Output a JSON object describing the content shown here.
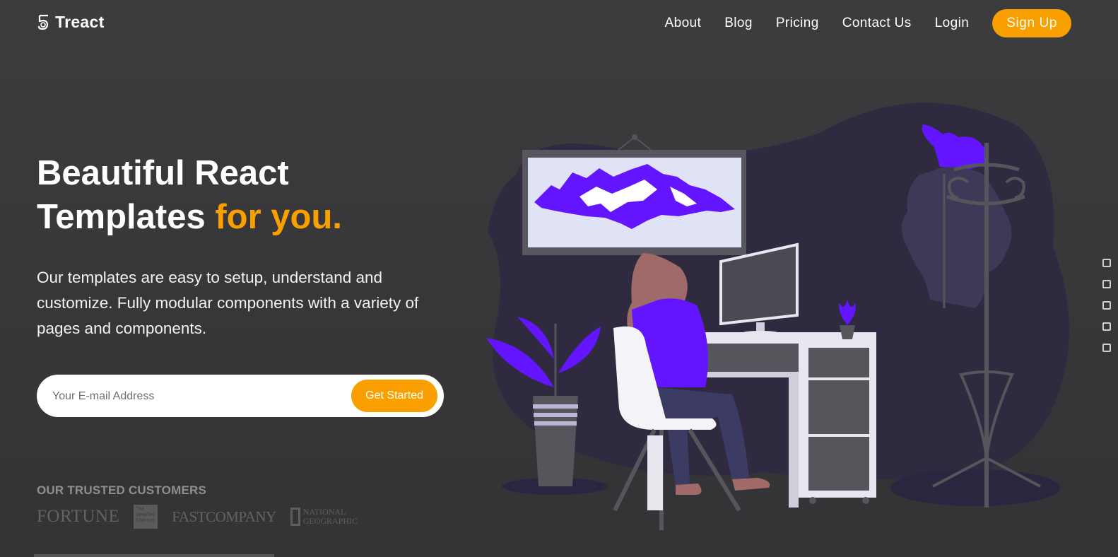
{
  "header": {
    "brand": "Treact",
    "nav_links": [
      "About",
      "Blog",
      "Pricing",
      "Contact Us",
      "Login"
    ],
    "signup_label": "Sign Up"
  },
  "hero": {
    "title_line1": "Beautiful React",
    "title_line2": "Templates",
    "title_accent": "for you.",
    "description": "Our templates are easy to setup, understand and customize. Fully modular components with a variety of pages and components.",
    "email_placeholder": "Your E-mail Address",
    "cta_label": "Get Started"
  },
  "customers": {
    "title": "OUR TRUSTED CUSTOMERS",
    "logos": {
      "fortune": "FORTUNE",
      "weather": "The Weather Channel",
      "fastcompany": "FASTCOMPANY",
      "natgeo_line1": "NATIONAL",
      "natgeo_line2": "GEOGRAPHIC"
    }
  },
  "colors": {
    "accent": "#f9a000",
    "illustration_primary": "#6415ff",
    "background": "#3a3a3c"
  },
  "icons": [
    "logo-icon",
    "side-pin-icon",
    "side-camera-icon",
    "side-square-icon",
    "side-copy-icon",
    "side-gear-icon"
  ]
}
